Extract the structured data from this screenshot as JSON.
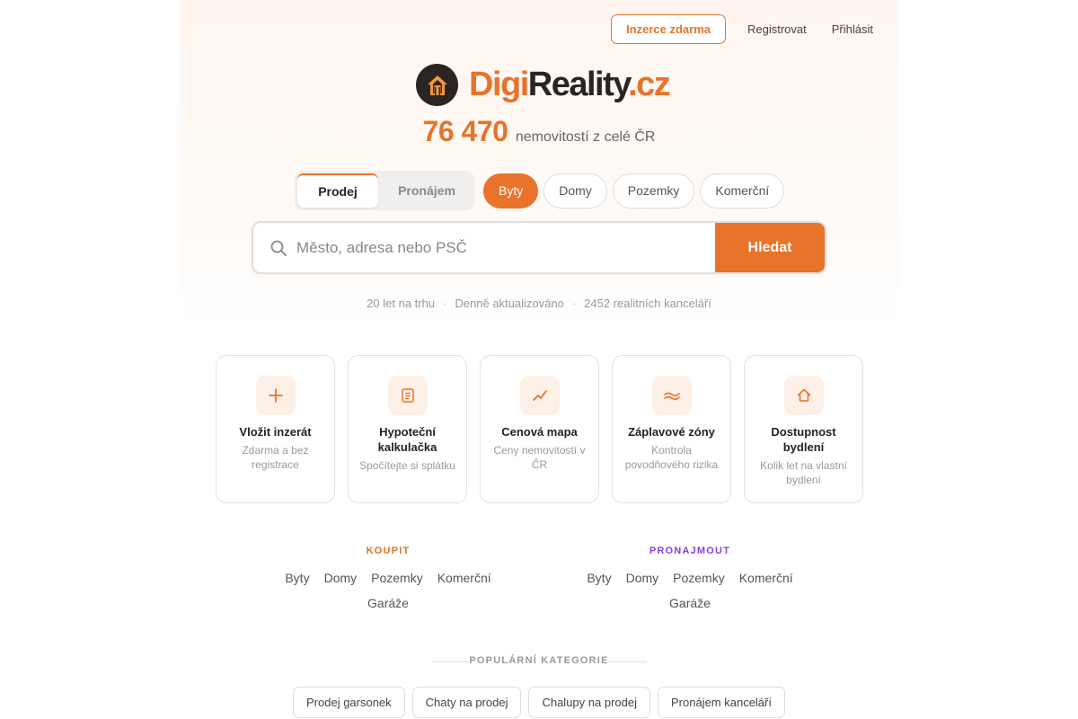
{
  "topnav": {
    "advertise_label": "Inzerce zdarma",
    "register_label": "Registrovat",
    "login_label": "Přihlásit"
  },
  "brand": {
    "part1": "Digi",
    "part2": "Reality",
    "part3": ".cz",
    "accent_color": "#e8732a",
    "dark_color": "#2a2523"
  },
  "listing_count": {
    "number": "76 470",
    "label": "nemovitostí z celé ČR"
  },
  "transaction_tabs": [
    {
      "label": "Prodej",
      "active": true
    },
    {
      "label": "Pronájem",
      "active": false
    }
  ],
  "property_types": [
    {
      "label": "Byty",
      "active": true
    },
    {
      "label": "Domy",
      "active": false
    },
    {
      "label": "Pozemky",
      "active": false
    },
    {
      "label": "Komerční",
      "active": false
    }
  ],
  "search": {
    "placeholder": "Město, adresa nebo PSČ",
    "value": "",
    "button_label": "Hledat",
    "icon": "search-icon"
  },
  "stats": [
    "20 let na trhu",
    "Denně aktualizováno",
    "2452 realitních kanceláří"
  ],
  "cards": [
    {
      "icon": "plus-icon",
      "title": "Vložit inzerát",
      "subtitle": "Zdarma a bez registrace"
    },
    {
      "icon": "document-icon",
      "title": "Hypoteční kalkulačka",
      "subtitle": "Spočítejte si splátku"
    },
    {
      "icon": "chart-line-icon",
      "title": "Cenová mapa",
      "subtitle": "Ceny nemovitostí v ČR"
    },
    {
      "icon": "waves-icon",
      "title": "Záplavové zóny",
      "subtitle": "Kontrola povodňového rizika"
    },
    {
      "icon": "house-icon",
      "title": "Dostupnost bydlení",
      "subtitle": "Kolik let na vlastní bydlení"
    }
  ],
  "buy": {
    "heading": "KOUPIT",
    "links": [
      "Byty",
      "Domy",
      "Pozemky",
      "Komerční",
      "Garáže"
    ],
    "color": "#d9771f"
  },
  "rent": {
    "heading": "PRONAJMOUT",
    "links": [
      "Byty",
      "Domy",
      "Pozemky",
      "Komerční",
      "Garáže"
    ],
    "color": "#8a3fdc"
  },
  "popular": {
    "heading": "POPULÁRNÍ KATEGORIE",
    "chips": [
      "Prodej garsonek",
      "Chaty na prodej",
      "Chalupy na prodej",
      "Pronájem kanceláří"
    ]
  }
}
